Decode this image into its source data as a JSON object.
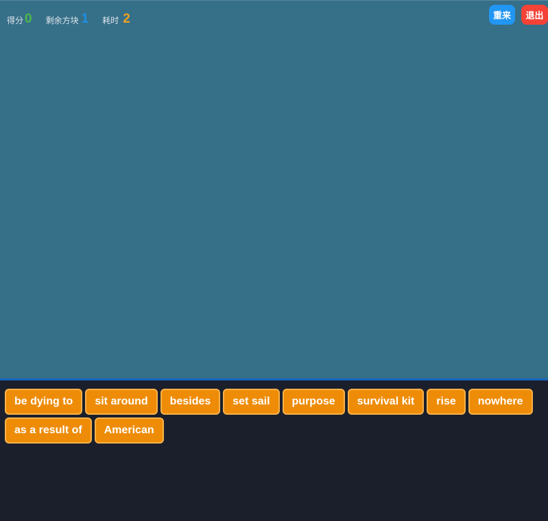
{
  "header": {
    "score_label": "得分",
    "score_value": "0",
    "blocks_label": "剩余方块",
    "blocks_value": "1",
    "time_label": "耗时",
    "time_value": "2"
  },
  "buttons": {
    "restart_label": "重来",
    "exit_label": "退出"
  },
  "colors": {
    "play_area": "#366f88",
    "tray": "#1a1f2b",
    "tile": "#ee8c08",
    "score": "#4cb84c",
    "blocks": "#1e90e8",
    "time": "#f0a020",
    "restart": "#2196f3",
    "exit": "#f44336"
  },
  "words": [
    "be dying to",
    "sit around",
    "besides",
    "set sail",
    "purpose",
    "survival kit",
    "rise",
    "nowhere",
    "as a result of",
    "American"
  ]
}
